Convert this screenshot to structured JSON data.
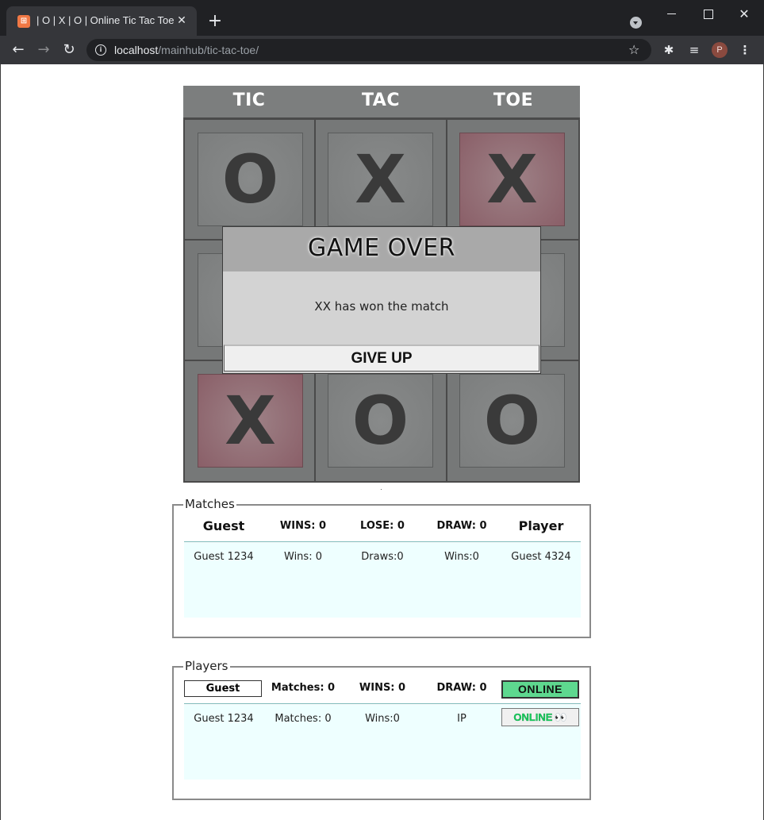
{
  "browser": {
    "tab_title": "| O | X | O | Online Tic Tac Toe",
    "favicon_glyph": "⊞",
    "new_tab": "+",
    "url_host": "localhost",
    "url_path": "/mainhub/tic-tac-toe/",
    "avatar_letter": "P",
    "icons": [
      "favicon",
      "tab-close-icon",
      "new-tab-icon",
      "tab-search-icon",
      "minimize-icon",
      "maximize-icon",
      "close-icon",
      "back-icon",
      "forward-icon",
      "reload-icon",
      "info-icon",
      "star-icon",
      "puzzle-icon",
      "media-icon",
      "avatar",
      "more-menu-icon"
    ]
  },
  "board": {
    "headers": [
      "TIC",
      "TAC",
      "TOE"
    ],
    "cells": [
      {
        "mark": "O",
        "win": false
      },
      {
        "mark": "X",
        "win": false
      },
      {
        "mark": "X",
        "win": true
      },
      {
        "mark": "",
        "win": false
      },
      {
        "mark": "",
        "win": false
      },
      {
        "mark": "",
        "win": false
      },
      {
        "mark": "X",
        "win": true
      },
      {
        "mark": "O",
        "win": false
      },
      {
        "mark": "O",
        "win": false
      }
    ],
    "win_color": "#8a5f68",
    "cell_color": "#7c7e7e"
  },
  "dialog": {
    "title": "GAME OVER",
    "message": "XX has won the match",
    "button": "GIVE UP"
  },
  "matches": {
    "legend": "Matches",
    "header": [
      "Guest",
      "WINS: 0",
      "LOSE: 0",
      "DRAW: 0",
      "Player"
    ],
    "rows": [
      [
        "Guest 1234",
        "Wins: 0",
        "Draws:0",
        "Wins:0",
        "Guest 4324"
      ]
    ]
  },
  "players": {
    "legend": "Players",
    "header": [
      "Guest",
      "Matches: 0",
      "WINS: 0",
      "DRAW: 0",
      "ONLINE"
    ],
    "rows": [
      [
        "Guest 1234",
        "Matches: 0",
        "Wins:0",
        "IP",
        "ONLINE"
      ]
    ],
    "eyes": "👀",
    "online_color": "#5ed88f"
  }
}
